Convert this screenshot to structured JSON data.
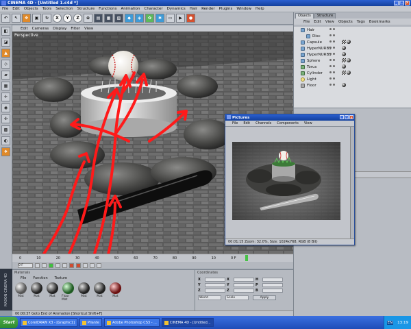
{
  "window": {
    "title": "CINEMA 4D - [Untitled 1.c4d *]",
    "controls": [
      "minimize-icon",
      "maximize-icon",
      "close-icon"
    ]
  },
  "menubar": [
    "File",
    "Edit",
    "Objects",
    "Tools",
    "Selection",
    "Structure",
    "Functions",
    "Animation",
    "Character",
    "Dynamics",
    "Hair",
    "Render",
    "Plugins",
    "Window",
    "Help"
  ],
  "toolbar": {
    "icons": [
      "undo-icon",
      "pointer-icon",
      "move-icon",
      "scale-icon",
      "rotate-icon",
      "x-axis-icon",
      "y-axis-icon",
      "z-axis-icon",
      "coord-icon",
      "render-view-icon",
      "render-icon",
      "render-settings-icon",
      "cube-icon",
      "nurbs-icon",
      "array-icon",
      "deformer-icon",
      "scene-icon",
      "camera-icon",
      "light-icon"
    ],
    "axis_labels": [
      "X",
      "Y",
      "Z"
    ]
  },
  "viewport": {
    "menu": [
      "Edit",
      "Cameras",
      "Display",
      "Filter",
      "View"
    ],
    "label": "Perspective"
  },
  "timeline": {
    "ticks": [
      "0",
      "10",
      "20",
      "30",
      "40",
      "50",
      "60",
      "70",
      "80",
      "90",
      "10",
      "0 F"
    ],
    "frame_field": "0 F"
  },
  "materials": {
    "header": "Materials",
    "menu": [
      "File",
      "Function",
      "Texture"
    ],
    "items": [
      {
        "name": "Mat",
        "color": "grey"
      },
      {
        "name": "Mat",
        "color": "dark"
      },
      {
        "name": "Mat",
        "color": "dark"
      },
      {
        "name": "Floor Mat",
        "color": "green"
      },
      {
        "name": "Mat",
        "color": "dark"
      },
      {
        "name": "Mat",
        "color": "dark"
      },
      {
        "name": "Mat",
        "color": "red"
      }
    ]
  },
  "coordinates": {
    "header": "Coordinates",
    "rows": [
      {
        "a": "X",
        "b": "X",
        "c": "H"
      },
      {
        "a": "Y",
        "b": "Y",
        "c": "P"
      },
      {
        "a": "Z",
        "b": "Z",
        "c": "B"
      }
    ],
    "mode_select": "World",
    "size_select": "Scale",
    "apply_label": "Apply"
  },
  "status": "00:00:37  Goto End of Animation [Shortcut Shift+F]",
  "objects_panel": {
    "tabs": [
      "Objects",
      "Structure"
    ],
    "menu": [
      "File",
      "Edit",
      "View",
      "Objects",
      "Tags",
      "Bookmarks"
    ],
    "items": [
      {
        "name": "Hair",
        "icon": "hair-icon",
        "indent": false,
        "tags": []
      },
      {
        "name": "Disc",
        "icon": "disc-icon",
        "indent": true,
        "tags": []
      },
      {
        "name": "Capsule",
        "icon": "capsule-icon",
        "indent": false,
        "tags": [
          "check",
          "ball"
        ]
      },
      {
        "name": "HyperNURBS",
        "icon": "hypernurbs-icon",
        "indent": false,
        "tags": [
          "ball"
        ]
      },
      {
        "name": "HyperNURBS",
        "icon": "hypernurbs-icon",
        "indent": false,
        "tags": [
          "ball"
        ]
      },
      {
        "name": "Sphere",
        "icon": "sphere-icon",
        "indent": false,
        "tags": [
          "check",
          "ball"
        ]
      },
      {
        "name": "Torus",
        "icon": "torus-icon",
        "indent": false,
        "tags": [
          "ball"
        ]
      },
      {
        "name": "Cylinder",
        "icon": "cylinder-icon",
        "indent": false,
        "tags": [
          "check",
          "ball"
        ]
      },
      {
        "name": "Light",
        "icon": "light-icon",
        "indent": false,
        "tags": []
      },
      {
        "name": "Floor",
        "icon": "floor-icon",
        "indent": false,
        "tags": [
          "ball"
        ]
      }
    ]
  },
  "pictures_window": {
    "title": "Pictures",
    "menu": [
      "File",
      "Edit",
      "Channels",
      "Components",
      "View"
    ],
    "status": "00:01:15   Zoom: 32.0%,  Size: 1024x768, RGB (8 Bit)"
  },
  "taskbar": {
    "start_label": "Start",
    "tasks": [
      {
        "label": "CorelDRAW X3 - [Graphic1]",
        "active": false
      },
      {
        "label": "Pliante",
        "active": false
      },
      {
        "label": "Adobe Photoshop CS3 - ...",
        "active": false
      },
      {
        "label": "CINEMA 4D - [Untitled...",
        "active": true
      }
    ],
    "lang": "EN",
    "clock": "13:19"
  },
  "colors": {
    "title_bar": "#1f4db8",
    "annotation_red": "#ff1a1a",
    "ui_grey": "#b3b7bf"
  }
}
